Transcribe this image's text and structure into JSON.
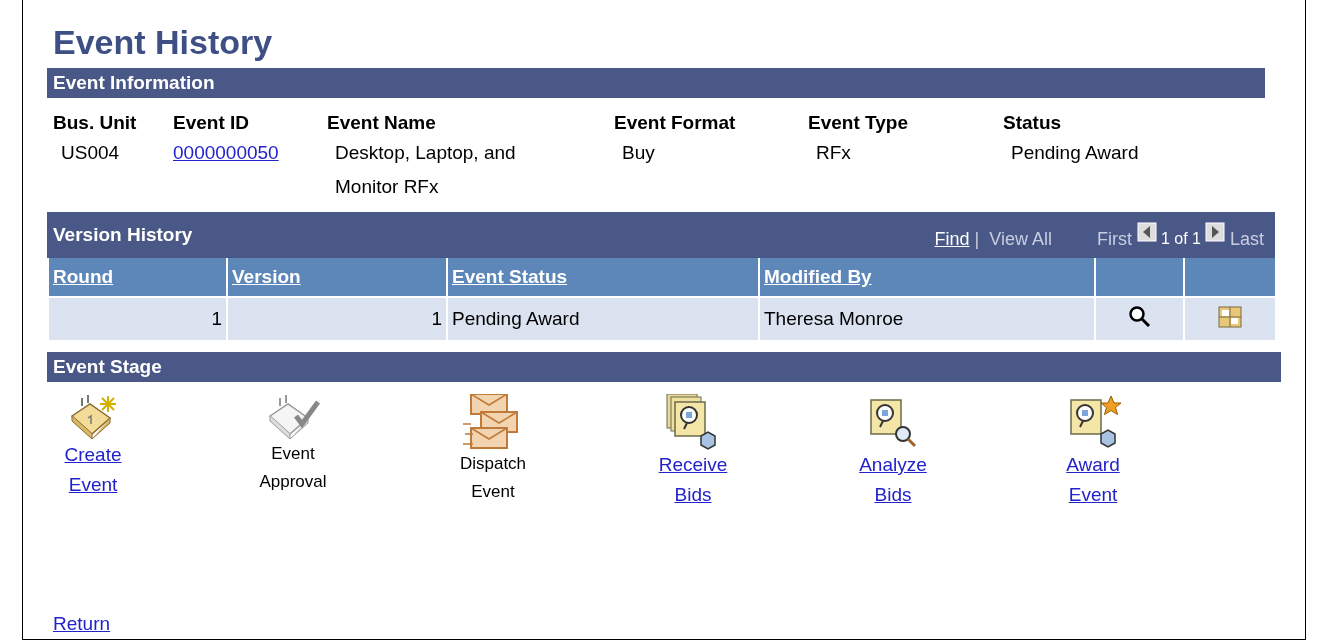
{
  "title": "Event History",
  "event_information": {
    "heading": "Event Information",
    "fields": [
      {
        "label": "Bus. Unit",
        "value": "US004",
        "link": false
      },
      {
        "label": "Event ID",
        "value": "0000000050",
        "link": true
      },
      {
        "label": "Event Name",
        "value": "Desktop, Laptop, and Monitor RFx",
        "link": false
      },
      {
        "label": "Event Format",
        "value": "Buy",
        "link": false
      },
      {
        "label": "Event Type",
        "value": "RFx",
        "link": false
      },
      {
        "label": "Status",
        "value": "Pending Award",
        "link": false
      }
    ]
  },
  "version_history": {
    "heading": "Version History",
    "find": "Find",
    "separator": "|",
    "view_all": "View All",
    "first": "First",
    "count": "1 of 1",
    "last": "Last",
    "columns": [
      "Round",
      "Version",
      "Event Status",
      "Modified By"
    ],
    "rows": [
      {
        "round": "1",
        "version": "1",
        "event_status": "Pending Award",
        "modified_by": "Theresa Monroe"
      }
    ]
  },
  "event_stage": {
    "heading": "Event Stage",
    "stages": [
      {
        "kind": "calendar-star",
        "label": "Create Event",
        "enabled": true
      },
      {
        "kind": "calendar-check",
        "label": "Event Approval",
        "enabled": false
      },
      {
        "kind": "envelopes",
        "label": "Dispatch Event",
        "enabled": false
      },
      {
        "kind": "bids-stack",
        "label": "Receive Bids",
        "enabled": true
      },
      {
        "kind": "bids-search",
        "label": "Analyze Bids",
        "enabled": true
      },
      {
        "kind": "bids-star",
        "label": "Award Event",
        "enabled": true
      }
    ]
  },
  "return_link": "Return"
}
